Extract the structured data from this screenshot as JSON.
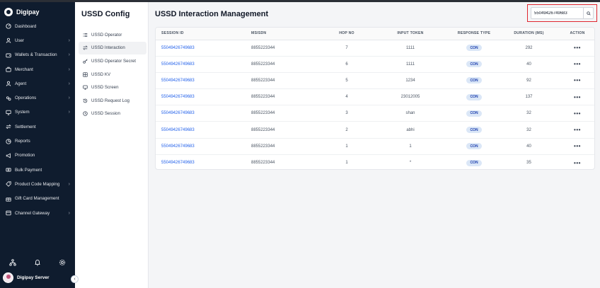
{
  "brand": {
    "name": "Digipay"
  },
  "sidebar": {
    "items": [
      {
        "label": "Dashboard",
        "icon": "dashboard-icon",
        "chevron": false
      },
      {
        "label": "User",
        "icon": "user-icon",
        "chevron": true
      },
      {
        "label": "Wallets & Transaction",
        "icon": "wallet-icon",
        "chevron": true
      },
      {
        "label": "Merchant",
        "icon": "merchant-icon",
        "chevron": true
      },
      {
        "label": "Agent",
        "icon": "agent-icon",
        "chevron": true
      },
      {
        "label": "Operations",
        "icon": "operations-icon",
        "chevron": true
      },
      {
        "label": "System",
        "icon": "system-icon",
        "chevron": true
      },
      {
        "label": "Settlement",
        "icon": "settlement-icon",
        "chevron": false
      },
      {
        "label": "Reports",
        "icon": "reports-icon",
        "chevron": false
      },
      {
        "label": "Promotion",
        "icon": "promotion-icon",
        "chevron": false
      },
      {
        "label": "Bulk Payment",
        "icon": "bulk-payment-icon",
        "chevron": false
      },
      {
        "label": "Product Code Mapping",
        "icon": "product-code-icon",
        "chevron": true
      },
      {
        "label": "Gift Card Management",
        "icon": "gift-card-icon",
        "chevron": false
      },
      {
        "label": "Channel Gateway",
        "icon": "channel-gateway-icon",
        "chevron": true
      }
    ],
    "chevron_glyph": "›"
  },
  "user": {
    "name": "Digipay Server"
  },
  "submenu": {
    "title": "USSD Config",
    "items": [
      {
        "label": "USSD Operator",
        "icon": "list-icon"
      },
      {
        "label": "USSD Interaction",
        "icon": "swap-icon",
        "active": true
      },
      {
        "label": "USSD Operator Secret",
        "icon": "key-icon"
      },
      {
        "label": "USSD KV",
        "icon": "key-value-icon"
      },
      {
        "label": "USSD Screen",
        "icon": "screen-icon"
      },
      {
        "label": "USSD Request Log",
        "icon": "history-icon"
      },
      {
        "label": "USSD Session",
        "icon": "clock-icon"
      }
    ]
  },
  "main": {
    "title": "USSD Interaction Management",
    "search": {
      "value": "55049426749683"
    }
  },
  "table": {
    "headers": {
      "session_id": "SESSION ID",
      "msisdn": "MSISDN",
      "hop_no": "HOP NO",
      "input_token": "INPUT TOKEN",
      "response_type": "RESPONSE TYPE",
      "duration": "DURATION (MS)",
      "action": "ACTION"
    },
    "rows": [
      {
        "session_id": "55049426749683",
        "msisdn": "8855223344",
        "hop_no": "7",
        "input_token": "1111",
        "response_type": "CON",
        "duration": "292",
        "action": "•••"
      },
      {
        "session_id": "55049426749683",
        "msisdn": "8855223344",
        "hop_no": "6",
        "input_token": "1111",
        "response_type": "CON",
        "duration": "40",
        "action": "•••"
      },
      {
        "session_id": "55049426749683",
        "msisdn": "8855223344",
        "hop_no": "5",
        "input_token": "1234",
        "response_type": "CON",
        "duration": "92",
        "action": "•••"
      },
      {
        "session_id": "55049426749683",
        "msisdn": "8855223344",
        "hop_no": "4",
        "input_token": "23012005",
        "response_type": "CON",
        "duration": "137",
        "action": "•••"
      },
      {
        "session_id": "55049426749683",
        "msisdn": "8855223344",
        "hop_no": "3",
        "input_token": "shan",
        "response_type": "CON",
        "duration": "32",
        "action": "•••"
      },
      {
        "session_id": "55049426749683",
        "msisdn": "8855223344",
        "hop_no": "2",
        "input_token": "abhi",
        "response_type": "CON",
        "duration": "32",
        "action": "•••"
      },
      {
        "session_id": "55049426749683",
        "msisdn": "8855223344",
        "hop_no": "1",
        "input_token": "1",
        "response_type": "CON",
        "duration": "40",
        "action": "•••"
      },
      {
        "session_id": "55049426749683",
        "msisdn": "8855223344",
        "hop_no": "1",
        "input_token": "*",
        "response_type": "CON",
        "duration": "35",
        "action": "•••"
      }
    ]
  },
  "colors": {
    "sidebar_bg": "#0f1c2e",
    "link": "#2563eb",
    "badge_bg": "#dbe7f7",
    "highlight_border": "#e0262f"
  }
}
